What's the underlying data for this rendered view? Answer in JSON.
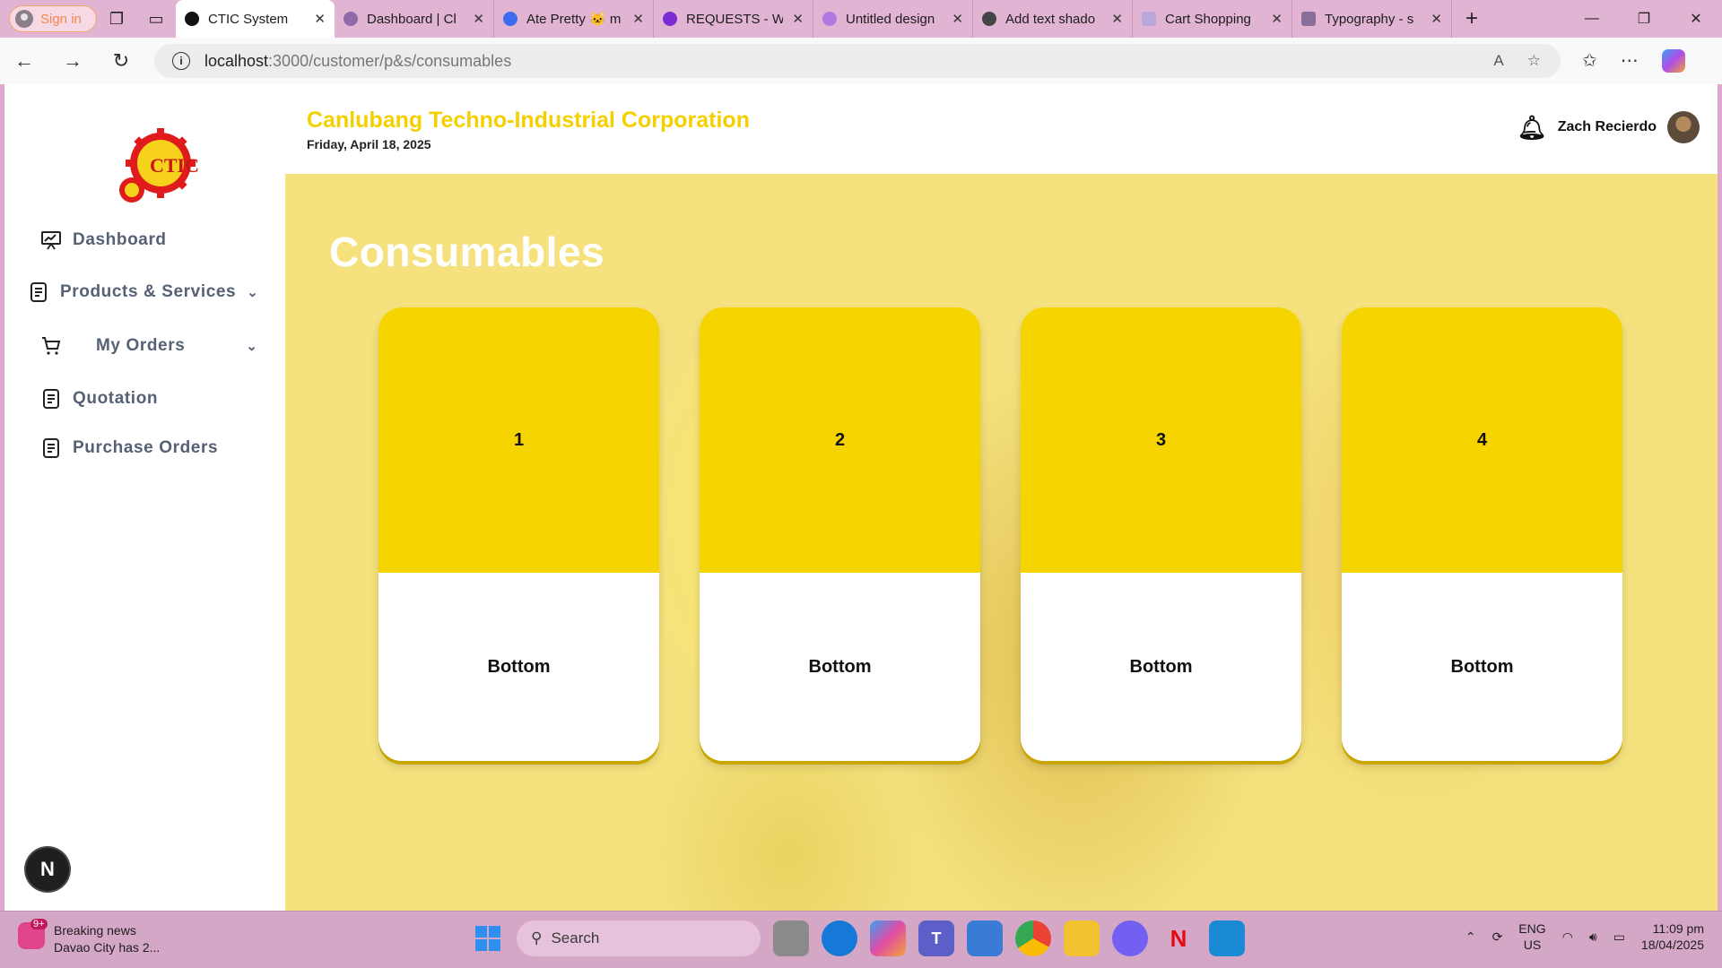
{
  "browser": {
    "signin_label": "Sign in",
    "tabs": [
      {
        "title": "CTIC System",
        "active": true,
        "color": "#111111"
      },
      {
        "title": "Dashboard | Cl",
        "active": false,
        "color": "#8e6aa8"
      },
      {
        "title": "Ate Pretty 🐱 m",
        "active": false,
        "color": "#3b6cf0"
      },
      {
        "title": "REQUESTS - W",
        "active": false,
        "color": "#7a2bd6"
      },
      {
        "title": "Untitled design",
        "active": false,
        "color": "#b477e0"
      },
      {
        "title": "Add text shado",
        "active": false,
        "color": "#444444"
      },
      {
        "title": "Cart Shopping",
        "active": false,
        "color": "#b9a7dc"
      },
      {
        "title": "Typography - s",
        "active": false,
        "color": "#8a6e9a"
      }
    ],
    "url_host": "localhost",
    "url_path": ":3000/customer/p&s/consumables"
  },
  "sidebar": {
    "items": [
      {
        "label": "Dashboard"
      },
      {
        "label": "Products & Services"
      },
      {
        "label": "My Orders"
      },
      {
        "label": "Quotation"
      },
      {
        "label": "Purchase Orders"
      }
    ],
    "logo_text": "CTIC",
    "devtools_badge": "N"
  },
  "header": {
    "company": "Canlubang Techno-Industrial Corporation",
    "date": "Friday, April 18, 2025",
    "user_name": "Zach Recierdo"
  },
  "main": {
    "title": "Consumables",
    "cards": [
      {
        "top": "1",
        "bottom": "Bottom"
      },
      {
        "top": "2",
        "bottom": "Bottom"
      },
      {
        "top": "3",
        "bottom": "Bottom"
      },
      {
        "top": "4",
        "bottom": "Bottom"
      }
    ]
  },
  "taskbar": {
    "news_title": "Breaking news",
    "news_sub": "Davao City has 2...",
    "news_badge": "9+",
    "search_label": "Search",
    "lang_1": "ENG",
    "lang_2": "US",
    "time": "11:09 pm",
    "date": "18/04/2025"
  },
  "colors": {
    "brand_yellow": "#f5d000",
    "card_yellow": "#f5d400",
    "sidebar_text": "#566175"
  }
}
